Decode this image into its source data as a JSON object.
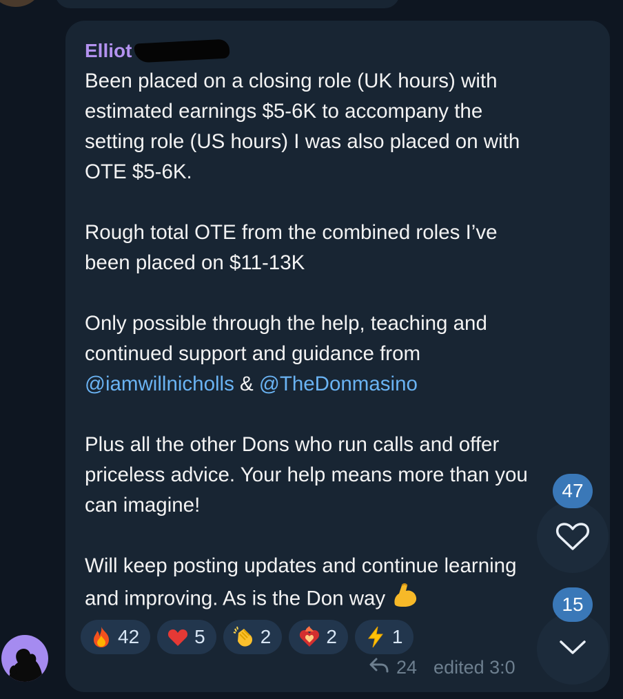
{
  "message": {
    "sender": "Elliot",
    "paragraphs": [
      [
        "Been placed on a closing role  (UK hours) with",
        "estimated earnings $5-6K to accompany the",
        "setting role (US hours) I was also placed on with",
        "OTE $5-6K."
      ],
      [
        "Rough total OTE from the combined roles I’ve",
        "been placed on $11-13K"
      ],
      [
        "Only possible through the help, teaching and",
        "continued support and guidance from"
      ],
      [
        "Plus all the other Dons who run calls and offer",
        "priceless advice. Your help means more than you",
        "can imagine!"
      ],
      [
        "Will keep posting updates and continue learning",
        "and improving. As is the Don way"
      ]
    ],
    "mention_1": "@iamwillnicholls",
    "mention_sep": " & ",
    "mention_2": "@TheDonmasino",
    "reactions": [
      {
        "emoji": "fire-icon",
        "count": "42"
      },
      {
        "emoji": "heart-icon",
        "count": "5"
      },
      {
        "emoji": "clapping-hands-icon",
        "count": "2"
      },
      {
        "emoji": "heart-on-fire-icon",
        "count": "2"
      },
      {
        "emoji": "lightning-icon",
        "count": "1"
      }
    ],
    "replies": "24",
    "edited_label": "edited 3:0"
  },
  "side": {
    "like_badge": "47",
    "unread_badge": "15"
  },
  "colors": {
    "background": "#0e1621",
    "bubble": "#182533",
    "sender": "#b392f0",
    "mention": "#6ab3f3",
    "badge": "#3a78b8"
  }
}
